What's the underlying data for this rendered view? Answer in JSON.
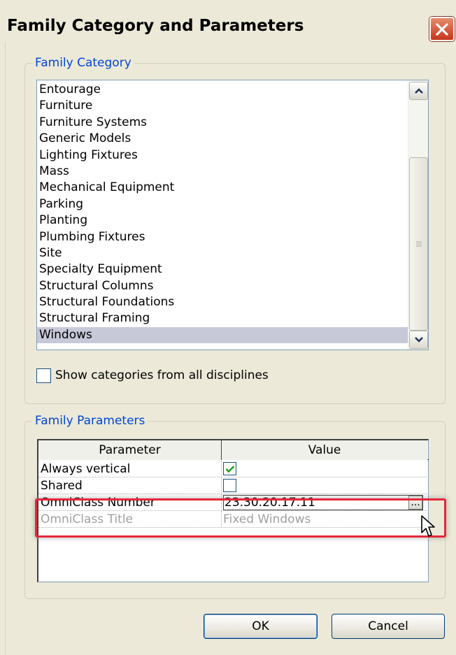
{
  "window": {
    "title": "Family Category and Parameters"
  },
  "family_category": {
    "legend": "Family Category",
    "items": [
      "Entourage",
      "Furniture",
      "Furniture Systems",
      "Generic Models",
      "Lighting Fixtures",
      "Mass",
      "Mechanical Equipment",
      "Parking",
      "Planting",
      "Plumbing Fixtures",
      "Site",
      "Specialty Equipment",
      "Structural Columns",
      "Structural Foundations",
      "Structural Framing",
      "Windows"
    ],
    "selected": "Windows",
    "show_all_label": "Show categories from all disciplines",
    "show_all_checked": false
  },
  "family_parameters": {
    "legend": "Family Parameters",
    "columns": [
      "Parameter",
      "Value"
    ],
    "rows": [
      {
        "parameter": "Always vertical",
        "value": "",
        "checked": true
      },
      {
        "parameter": "Shared",
        "value": "",
        "checked": false
      },
      {
        "parameter": "OmniClass Number",
        "value": "23.30.20.17.11",
        "edit_button": "..."
      },
      {
        "parameter": "OmniClass Title",
        "value": "Fixed Windows",
        "disabled": true
      }
    ]
  },
  "buttons": {
    "ok": "OK",
    "cancel": "Cancel"
  },
  "colors": {
    "dialog_bg": "#ece9d8",
    "legend_text": "#0046d5",
    "selection": "#c7c8d8",
    "highlight_box": "#e5283a",
    "check_green": "#21a121",
    "close_red": "#c5371c"
  }
}
